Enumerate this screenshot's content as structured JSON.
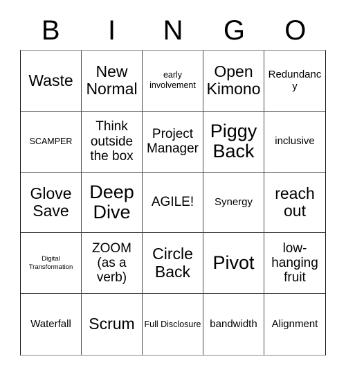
{
  "card": {
    "title": "Buzzword Bingo Card",
    "header_letters": [
      "B",
      "I",
      "N",
      "G",
      "O"
    ],
    "grid_size": 5,
    "colors": {
      "text": "#000000",
      "cell_border": "#4a4a4a",
      "outer_border": "#1a1a1a",
      "outer_border_soft": "#8a8a8a",
      "background": "#ffffff"
    },
    "rows": [
      [
        {
          "text": "Waste",
          "size": "xl"
        },
        {
          "text": "New Normal",
          "size": "xl"
        },
        {
          "text": "early involvement",
          "size": "sm"
        },
        {
          "text": "Open Kimono",
          "size": "xl"
        },
        {
          "text": "Redundancy",
          "size": "md"
        }
      ],
      [
        {
          "text": "SCAMPER",
          "size": "sm"
        },
        {
          "text": "Think outside the box",
          "size": "lg"
        },
        {
          "text": "Project Manager",
          "size": "lg"
        },
        {
          "text": "Piggy Back",
          "size": "xxl"
        },
        {
          "text": "inclusive",
          "size": "md"
        }
      ],
      [
        {
          "text": "Glove Save",
          "size": "xl"
        },
        {
          "text": "Deep Dive",
          "size": "xxl"
        },
        {
          "text": "AGILE!",
          "size": "lg"
        },
        {
          "text": "Synergy",
          "size": "md"
        },
        {
          "text": "reach out",
          "size": "xl"
        }
      ],
      [
        {
          "text": "Digital Transformation",
          "size": "xs"
        },
        {
          "text": "ZOOM (as a verb)",
          "size": "lg"
        },
        {
          "text": "Circle Back",
          "size": "xl"
        },
        {
          "text": "Pivot",
          "size": "xxl"
        },
        {
          "text": "low-hanging fruit",
          "size": "lg"
        }
      ],
      [
        {
          "text": "Waterfall",
          "size": "md"
        },
        {
          "text": "Scrum",
          "size": "xl"
        },
        {
          "text": "Full Disclosure",
          "size": "sm"
        },
        {
          "text": "bandwidth",
          "size": "md"
        },
        {
          "text": "Alignment",
          "size": "md"
        }
      ]
    ]
  }
}
